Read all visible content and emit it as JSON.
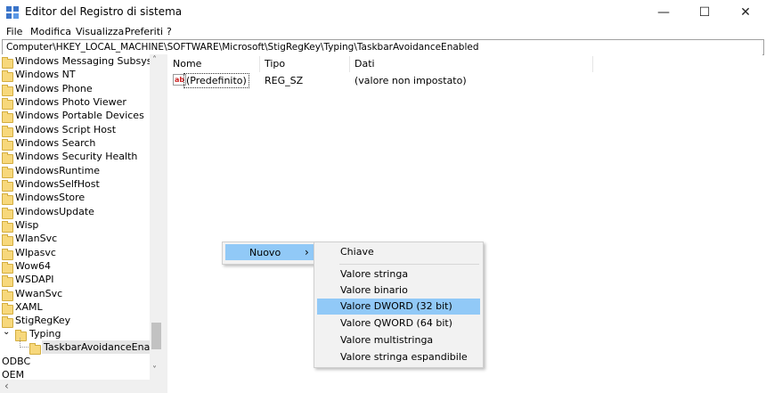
{
  "window": {
    "title": "Editor del Registro di sistema",
    "controls": {
      "minimize": "—",
      "maximize": "☐",
      "close": "✕"
    }
  },
  "menu": [
    "File",
    "Modifica",
    "Visualizza",
    "Preferiti",
    "?"
  ],
  "address": "Computer\\HKEY_LOCAL_MACHINE\\SOFTWARE\\Microsoft\\StigRegKey\\Typing\\TaskbarAvoidanceEnabled",
  "tree": {
    "items": [
      "Windows Messaging Subsystem",
      "Windows NT",
      "Windows Phone",
      "Windows Photo Viewer",
      "Windows Portable Devices",
      "Windows Script Host",
      "Windows Search",
      "Windows Security Health",
      "WindowsRuntime",
      "WindowsSelfHost",
      "WindowsStore",
      "WindowsUpdate",
      "Wisp",
      "WlanSvc",
      "Wlpasvc",
      "Wow64",
      "WSDAPI",
      "WwanSvc",
      "XAML",
      "StigRegKey"
    ],
    "typing": "Typing",
    "selected": "TaskbarAvoidanceEnabled",
    "odbc": "ODBC",
    "oem": "OEM",
    "expand_glyph": "⌄"
  },
  "columns": {
    "name": "Nome",
    "type": "Tipo",
    "data": "Dati"
  },
  "values": [
    {
      "icon": "ab",
      "name": "(Predefinito)",
      "type": "REG_SZ",
      "data": "(valore non impostato)"
    }
  ],
  "context_menu": {
    "new_label": "Nuovo",
    "arrow": "›",
    "submenu": {
      "key": "Chiave",
      "items": [
        "Valore stringa",
        "Valore binario",
        "Valore DWORD (32 bit)",
        "Valore QWORD (64 bit)",
        "Valore multistringa",
        "Valore stringa espandibile"
      ],
      "highlighted": "Valore DWORD (32 bit)"
    }
  },
  "scrollbar": {
    "up": "˄",
    "down": "˅",
    "left": "‹"
  },
  "colors": {
    "highlight": "#91c9f7",
    "folder": "#f7d87c"
  }
}
